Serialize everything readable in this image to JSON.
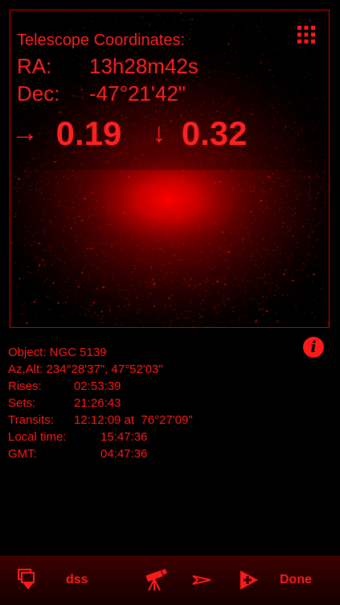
{
  "telescope": {
    "title": "Telescope Coordinates:",
    "ra_label": "RA:",
    "ra_value": "13h28m42s",
    "dec_label": "Dec:",
    "dec_value": "-47°21'42\""
  },
  "offset": {
    "right_arrow": "→",
    "right_value": "0.19",
    "down_arrow": "↓",
    "down_value": "0.32"
  },
  "object_info": {
    "object": "Object: NGC 5139",
    "azalt": "Az,Alt: 234°28'37\", 47°52'03\"",
    "rises_label": "Rises:",
    "rises_value": "02:53:39",
    "sets_label": "Sets:",
    "sets_value": "21:26:43",
    "transits_label": "Transits:",
    "transits_time": "12:12:09 at",
    "transits_alt": "76°27'09\"",
    "local_label": "Local time:",
    "local_value": "15:47:36",
    "gmt_label": "GMT:",
    "gmt_value": "04:47:36"
  },
  "toolbar": {
    "dss_label": "dss",
    "done_label": "Done"
  },
  "icons": {
    "grid": "grid-icon",
    "info": "info-icon",
    "layers": "layers-icon",
    "telescope": "telescope-icon",
    "pointer": "pointer-icon",
    "slew": "slew-icon"
  },
  "colors": {
    "accent": "#ff1a1a",
    "background": "#000000",
    "frame": "#d00000"
  }
}
